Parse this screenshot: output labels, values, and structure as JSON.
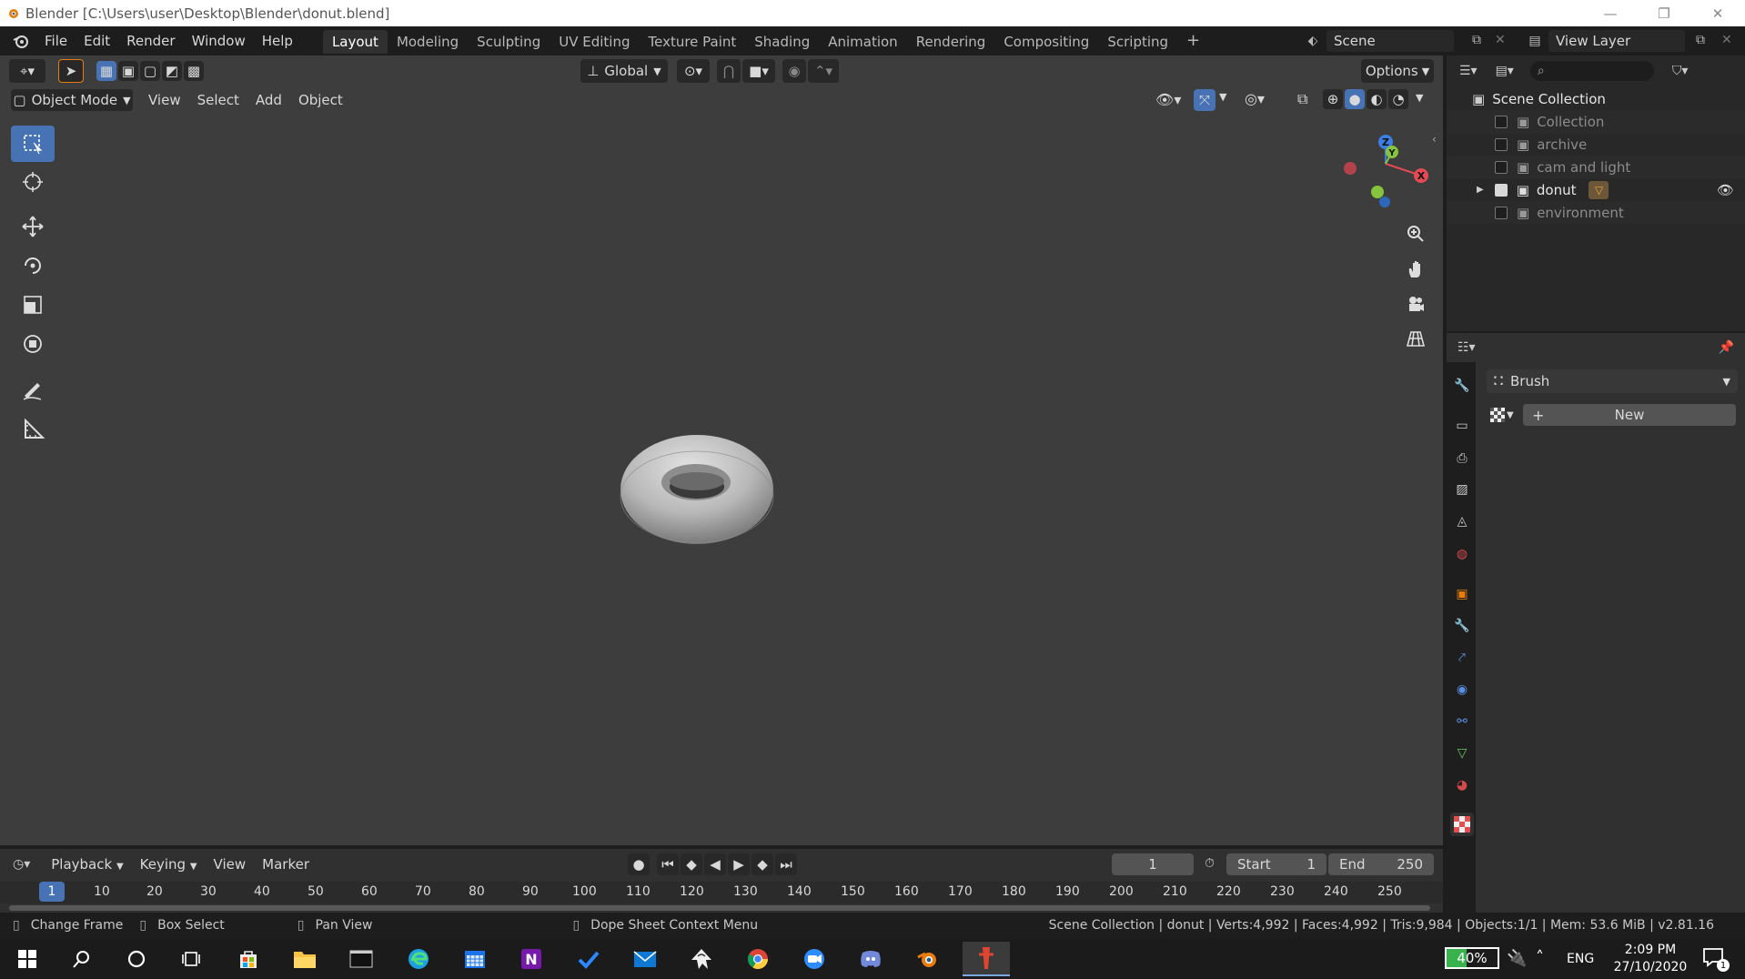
{
  "window": {
    "title": "Blender [C:\\Users\\user\\Desktop\\Blender\\donut.blend]"
  },
  "menu": [
    "File",
    "Edit",
    "Render",
    "Window",
    "Help"
  ],
  "workspaces": [
    "Layout",
    "Modeling",
    "Sculpting",
    "UV Editing",
    "Texture Paint",
    "Shading",
    "Animation",
    "Rendering",
    "Compositing",
    "Scripting"
  ],
  "active_workspace": "Layout",
  "scene": {
    "name": "Scene",
    "view_layer": "View Layer"
  },
  "viewport": {
    "transform_orientation": "Global",
    "options_label": "Options",
    "mode": "Object Mode",
    "menus": [
      "View",
      "Select",
      "Add",
      "Object"
    ],
    "gizmo_axes": {
      "x": "X",
      "y": "Y",
      "z": "Z"
    }
  },
  "outliner": {
    "root": "Scene Collection",
    "items": [
      {
        "label": "Collection",
        "checked": false
      },
      {
        "label": "archive",
        "checked": false
      },
      {
        "label": "cam and light",
        "checked": false
      },
      {
        "label": "donut",
        "checked": true
      },
      {
        "label": "environment",
        "checked": false
      }
    ]
  },
  "properties": {
    "brush_label": "Brush",
    "new_label": "New"
  },
  "timeline": {
    "menus": [
      "Playback",
      "Keying",
      "View",
      "Marker"
    ],
    "current_frame": "1",
    "start_label": "Start",
    "start_value": "1",
    "end_label": "End",
    "end_value": "250",
    "ticks": [
      "1",
      "10",
      "20",
      "30",
      "40",
      "50",
      "60",
      "70",
      "80",
      "90",
      "100",
      "110",
      "120",
      "130",
      "140",
      "150",
      "160",
      "170",
      "180",
      "190",
      "200",
      "210",
      "220",
      "230",
      "240",
      "250"
    ]
  },
  "statusbar": {
    "change_frame": "Change Frame",
    "box_select": "Box Select",
    "pan_view": "Pan View",
    "context_menu": "Dope Sheet Context Menu",
    "stats": "Scene Collection | donut | Verts:4,992 | Faces:4,992 | Tris:9,984 | Objects:1/1 | Mem: 53.6 MiB | v2.81.16"
  },
  "taskbar": {
    "battery": "40%",
    "language": "ENG",
    "time": "2:09 PM",
    "date": "27/10/2020",
    "notification_count": "1"
  },
  "colors": {
    "accent": "#4772b3",
    "viewport_bg": "#3d3d3d",
    "axis_x": "#e34a53",
    "axis_y": "#86c43b",
    "axis_z": "#3b7fe3"
  }
}
